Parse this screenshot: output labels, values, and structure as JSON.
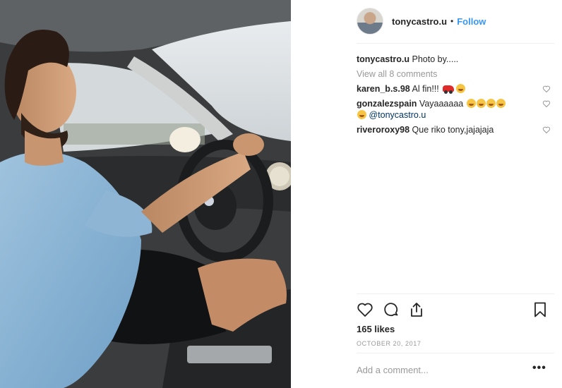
{
  "post": {
    "username": "tonycastro.u",
    "separator": "•",
    "follow_label": "Follow",
    "caption": "Photo by.....",
    "view_all_label": "View all 8 comments",
    "comments": [
      {
        "user": "karen_b.s.98",
        "text": "Al fin!!! ",
        "emojis": [
          "car",
          "laughing"
        ]
      },
      {
        "user": "gonzalezspain",
        "text": "Vayaaaaaa ",
        "emojis": [
          "laughing",
          "laughing",
          "laughing",
          "laughing",
          "laughing"
        ],
        "mention": "@tonycastro.u"
      },
      {
        "user": "riveroroxy98",
        "text": "Que riko tony,jajajaja"
      }
    ],
    "likes": "165 likes",
    "date": "OCTOBER 20, 2017",
    "add_comment_placeholder": "Add a comment...",
    "more_label": "•••"
  },
  "icons": {
    "like": "heart-icon",
    "comment": "comment-icon",
    "share": "share-icon",
    "save": "bookmark-icon"
  },
  "colors": {
    "link": "#3897f0",
    "muted": "#999999",
    "text": "#262626"
  }
}
